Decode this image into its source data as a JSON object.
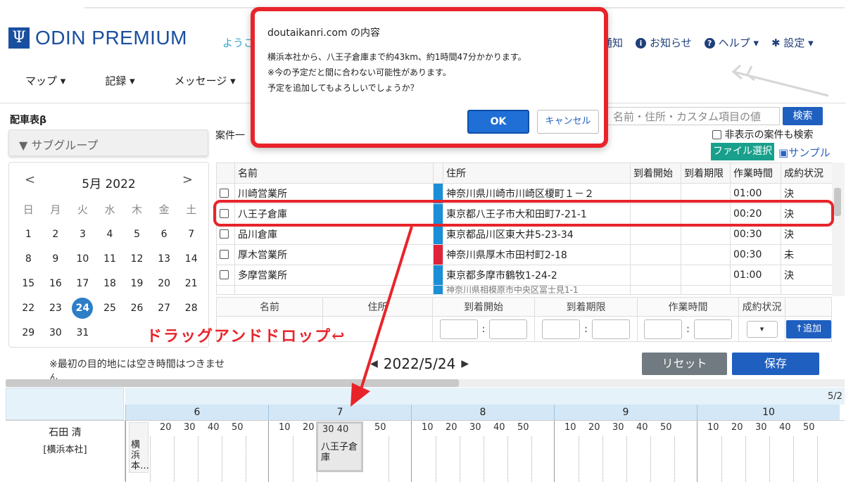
{
  "header": {
    "logo_mark": "Ψ",
    "logo_text": "ODIN PREMIUM",
    "welcome": "ようこ",
    "notify": "通知",
    "info": "お知らせ",
    "help": "ヘルプ",
    "settings": "設定"
  },
  "nav": [
    "マップ",
    "記録",
    "メッセージ"
  ],
  "panel": {
    "title": "配車表β",
    "subgroup": "▼ サブグループ"
  },
  "calendar": {
    "month": "5月 2022",
    "weekdays": [
      "日",
      "月",
      "火",
      "水",
      "木",
      "金",
      "土"
    ],
    "weeks": [
      [
        "1",
        "2",
        "3",
        "4",
        "5",
        "6",
        "7"
      ],
      [
        "8",
        "9",
        "10",
        "11",
        "12",
        "13",
        "14"
      ],
      [
        "15",
        "16",
        "17",
        "18",
        "19",
        "20",
        "21"
      ],
      [
        "22",
        "23",
        "24",
        "25",
        "26",
        "27",
        "28"
      ],
      [
        "29",
        "30",
        "31",
        "",
        "",
        "",
        ""
      ]
    ],
    "selected": "24"
  },
  "note": "※最初の目的地には空き時間はつきませ",
  "note2": "ん",
  "cases": {
    "label": "案件一",
    "search_placeholder": "名前・住所・カスタム項目の値",
    "search_btn": "検索",
    "hidden_chk": "非表示の案件も検索",
    "file_btn": "ファイル選択",
    "sample": "サンプル",
    "columns": [
      "名前",
      "住所",
      "到着開始",
      "到着期限",
      "作業時間",
      "成約状況"
    ],
    "rows": [
      {
        "name": "川崎営業所",
        "addr": "神奈川県川崎市川崎区榎町１－２",
        "start": "",
        "end": "",
        "work": "01:00",
        "status": "決",
        "marker": "blue"
      },
      {
        "name": "八王子倉庫",
        "addr": "東京都八王子市大和田町7-21-1",
        "start": "",
        "end": "",
        "work": "00:20",
        "status": "決",
        "marker": "blue"
      },
      {
        "name": "品川倉庫",
        "addr": "東京都品川区東大井5-23-34",
        "start": "",
        "end": "",
        "work": "00:30",
        "status": "決",
        "marker": "blue"
      },
      {
        "name": "厚木営業所",
        "addr": "神奈川県厚木市田村町2-18",
        "start": "",
        "end": "",
        "work": "00:30",
        "status": "未",
        "marker": "red"
      },
      {
        "name": "多摩営業所",
        "addr": "東京都多摩市鶴牧1-24-2",
        "start": "",
        "end": "",
        "work": "01:00",
        "status": "決",
        "marker": "blue"
      },
      {
        "name": "",
        "addr": "神奈川県相模原市中央区冨士見1-1",
        "start": "",
        "end": "",
        "work": "",
        "status": "",
        "marker": "blue"
      }
    ],
    "add_columns": [
      "名前",
      "住所",
      "到着開始",
      "到着期限",
      "作業時間",
      "成約状況"
    ],
    "add_btn": "↑追加"
  },
  "schedule": {
    "date": "2022/5/24",
    "reset": "リセット",
    "save": "保存",
    "date_short": "5/2",
    "hours": [
      "6",
      "7",
      "8",
      "9",
      "10"
    ],
    "ticks": [
      "10",
      "20",
      "30",
      "40",
      "50"
    ],
    "driver_name": "石田 清",
    "driver_office": "[横浜本社]",
    "job1": "横浜本…",
    "job2_ticks": "30 40",
    "job2": "八王子倉庫"
  },
  "annotation": {
    "dnd": "ドラッグアンドドロップ↩"
  },
  "dialog": {
    "title": "doutaikanri.com の内容",
    "line1": "横浜本社から、八王子倉庫まで約43km、約1時間47分かかります。",
    "line2": "※今の予定だと間に合わない可能性があります。",
    "line3": "予定を追加してもよろしいでしょうか？",
    "ok": "OK",
    "cancel": "キャンセル"
  },
  "colors": {
    "accent": "#1f5fbf",
    "highlight": "#e8242a",
    "teal": "#19a08c"
  }
}
